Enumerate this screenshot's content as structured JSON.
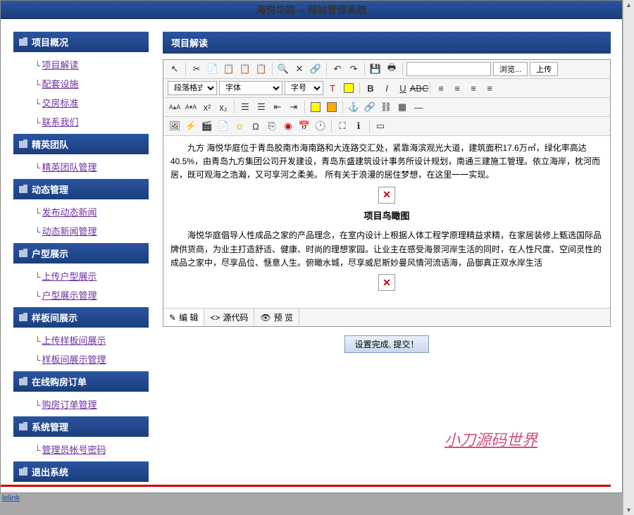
{
  "header": {
    "title": "海悦华庭 -- 网站管理系统"
  },
  "sidebar": {
    "groups": [
      {
        "title": "项目概况",
        "items": [
          {
            "label": "项目解读"
          },
          {
            "label": "配套设施"
          },
          {
            "label": "交房标准"
          },
          {
            "label": "联系我们"
          }
        ]
      },
      {
        "title": "精英团队",
        "items": [
          {
            "label": "精英团队管理"
          }
        ]
      },
      {
        "title": "动态管理",
        "items": [
          {
            "label": "发布动态新闻"
          },
          {
            "label": "动态新闻管理"
          }
        ]
      },
      {
        "title": "户型展示",
        "items": [
          {
            "label": "上传户型展示"
          },
          {
            "label": "户型展示管理"
          }
        ]
      },
      {
        "title": "样板间展示",
        "items": [
          {
            "label": "上传样板间展示"
          },
          {
            "label": "样板间展示管理"
          }
        ]
      },
      {
        "title": "在线购房订单",
        "items": [
          {
            "label": "购房订单管理"
          }
        ]
      },
      {
        "title": "系统管理",
        "items": [
          {
            "label": "管理员帐号密码"
          }
        ]
      },
      {
        "title": "退出系统",
        "items": []
      }
    ]
  },
  "content": {
    "panel_title": "项目解读",
    "toolbar": {
      "browse": "浏览...",
      "upload": "上传",
      "select_format": "段落格式",
      "select_font": "字体",
      "select_size": "字号"
    },
    "body": {
      "p1": "九方 海悦华庭位于青岛胶南市海南路和大连路交汇处，紧靠海滨观光大道，建筑面积17.6万㎡，绿化率高达40.5%，由青岛九方集团公司开发建设，青岛东盛建筑设计事务所设计规划，南通三建施工管理。依立海岸，枕河而居，既可观海之浩瀚，又可享河之柔美。 所有关于浪漫的居住梦想，在这里一一实现。",
      "h1": "项目鸟瞰图",
      "p2": "海悦华庭倡导人性成品之家的产品理念，在室内设计上根据人体工程学原理精益求精，在家居装修上甄选国际品牌供货商，为业主打造舒适、健康、时尚的理想家园。让业主在感受海景河岸生活的同时，在人性尺度、空间灵性的成品之家中，尽享品位、惬意人生。俯瞰水城，尽享威尼斯妙曼风情河流语海，品御真正双水岸生活"
    },
    "tabs": {
      "edit": "编 辑",
      "source": "源代码",
      "preview": "预 览"
    },
    "submit": "设置完成, 提交！"
  },
  "watermark": "小刀源码世界",
  "footer_link": "lelink"
}
